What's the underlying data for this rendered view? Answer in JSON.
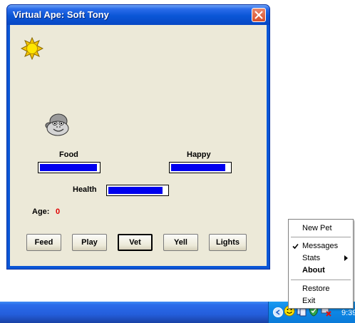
{
  "window": {
    "title": "Virtual Ape: Soft Tony"
  },
  "stats": {
    "food_label": "Food",
    "food_level": 0.97,
    "happy_label": "Happy",
    "happy_level": 0.93,
    "health_label": "Health",
    "health_level": 0.93,
    "age_label": "Age:",
    "age_value": "0"
  },
  "buttons": [
    {
      "label": "Feed"
    },
    {
      "label": "Play"
    },
    {
      "label": "Vet"
    },
    {
      "label": "Yell"
    },
    {
      "label": "Lights"
    }
  ],
  "tray_menu": {
    "items": [
      {
        "label": "New Pet"
      },
      {
        "label": "Messages",
        "checked": true
      },
      {
        "label": "Stats",
        "submenu": true
      },
      {
        "label": "About",
        "bold": true
      },
      {
        "label": "Restore"
      },
      {
        "label": "Exit"
      }
    ]
  },
  "taskbar": {
    "clock": "9:39"
  },
  "colors": {
    "bar_fill": "#0000ee",
    "age_value": "#e00000",
    "title_bar": "#0a56d6",
    "client": "#ece9d8"
  },
  "icons": {
    "day_indicator": "sun-icon",
    "pet": "ape-face-icon"
  }
}
